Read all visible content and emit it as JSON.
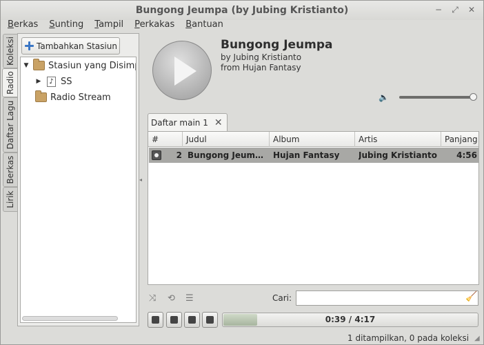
{
  "window": {
    "title": "Bungong Jeumpa (by Jubing Kristianto)"
  },
  "menu": [
    {
      "label": "Berkas",
      "mnemonic": "B",
      "rest": "erkas"
    },
    {
      "label": "Sunting",
      "mnemonic": "S",
      "rest": "unting"
    },
    {
      "label": "Tampil",
      "mnemonic": "T",
      "rest": "ampil"
    },
    {
      "label": "Perkakas",
      "mnemonic": "P",
      "rest": "erkakas"
    },
    {
      "label": "Bantuan",
      "mnemonic": "B",
      "rest": "antuan"
    }
  ],
  "side_tabs": [
    "Koleksi",
    "Radio",
    "Daftar Lagu",
    "Berkas",
    "Lirik"
  ],
  "side_tabs_active": "Radio",
  "radio": {
    "add_button": "Tambahkan Stasiun",
    "tree": {
      "saved_folder": "Stasiun yang Disimpan",
      "saved_child": "SS",
      "stream_folder": "Radio Stream"
    }
  },
  "now_playing": {
    "title": "Bungong Jeumpa",
    "artist_line": "by Jubing Kristianto",
    "album_line": "from Hujan Fantasy",
    "volume": 1.0
  },
  "playlist": {
    "tab_label": "Daftar main 1",
    "columns": {
      "num": "#",
      "title": "Judul",
      "album": "Album",
      "artist": "Artis",
      "length": "Panjang"
    },
    "rows": [
      {
        "num": "2",
        "title": "Bungong Jeum…",
        "album": "Hujan Fantasy",
        "artist": "Jubing Kristianto",
        "length": "4:56"
      }
    ]
  },
  "search": {
    "label": "Cari:",
    "value": ""
  },
  "progress": {
    "text": "0:39 / 4:17",
    "fraction": 0.132
  },
  "status": {
    "text": "1 ditampilkan, 0 pada koleksi"
  }
}
